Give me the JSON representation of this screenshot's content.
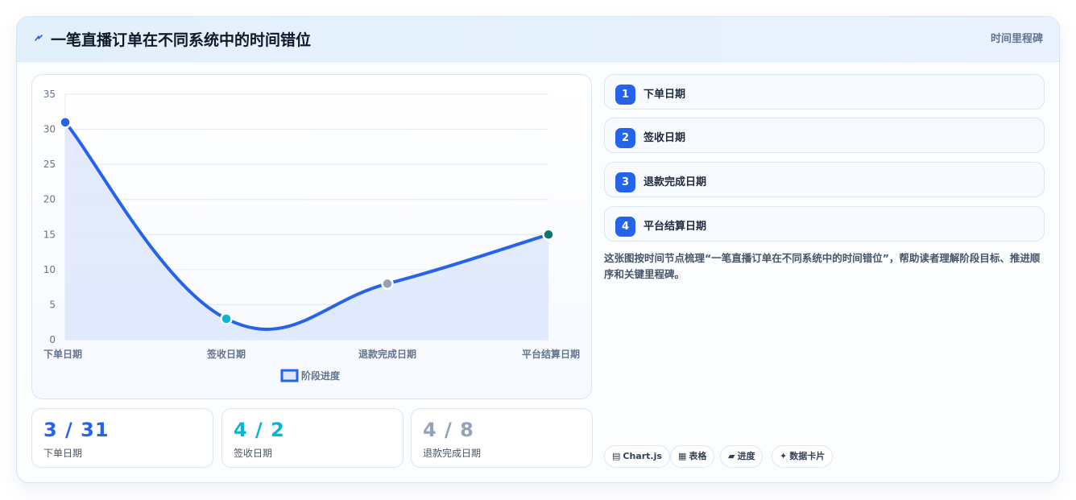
{
  "header": {
    "title": "一笔直播订单在不同系统中的时间错位",
    "tag": "时间里程碑",
    "icon": "bolt-icon"
  },
  "chart_data": {
    "type": "line",
    "categories": [
      "下单日期",
      "签收日期",
      "退款完成日期",
      "平台结算日期"
    ],
    "series": [
      {
        "name": "阶段进度",
        "values": [
          31,
          3,
          8,
          15
        ],
        "point_colors": [
          "#2563eb",
          "#06b6d4",
          "#94a3b8",
          "#0f766e"
        ]
      }
    ],
    "ylim": [
      0,
      35
    ],
    "yticks": [
      0,
      5,
      10,
      15,
      20,
      25,
      30,
      35
    ],
    "grid": true,
    "legend": "bottom",
    "line_color": "#2563eb",
    "fill_color": "#dde6fb"
  },
  "stats": [
    {
      "value": "3 / 31",
      "label": "下单日期",
      "color": "#2563eb"
    },
    {
      "value": "4 / 2",
      "label": "签收日期",
      "color": "#06b6d4"
    },
    {
      "value": "4 / 8",
      "label": "退款完成日期",
      "color": "#94a3b8"
    }
  ],
  "steps": [
    {
      "num": "1",
      "name": "下单日期"
    },
    {
      "num": "2",
      "name": "签收日期"
    },
    {
      "num": "3",
      "name": "退款完成日期"
    },
    {
      "num": "4",
      "name": "平台结算日期"
    }
  ],
  "description": "这张图按时间节点梳理“一笔直播订单在不同系统中的时间错位”，帮助读者理解阶段目标、推进顺序和关键里程碑。",
  "chips": [
    {
      "icon": "chart-icon",
      "glyph": "▤",
      "label": "Chart.js"
    },
    {
      "icon": "table-icon",
      "glyph": "▦",
      "label": "表格"
    },
    {
      "icon": "progress-icon",
      "glyph": "▰",
      "label": "进度"
    },
    {
      "icon": "sparkle-icon",
      "glyph": "✦",
      "label": "数据卡片"
    }
  ]
}
